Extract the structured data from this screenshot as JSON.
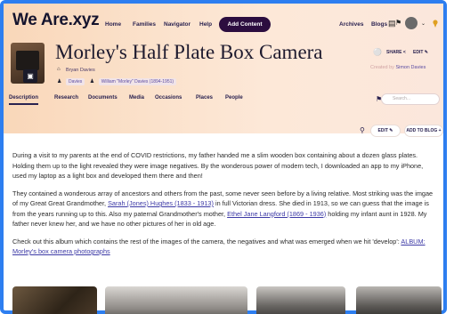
{
  "brand": {
    "logo": "We Are.xyz"
  },
  "topnav": {
    "links": [
      "Home",
      "Families",
      "Navigator",
      "Help"
    ],
    "add_content": "Add Content",
    "right_links": [
      "Archives",
      "Blogs"
    ]
  },
  "album": {
    "title": "Morley's Half Plate Box Camera",
    "owner": "Bryan Davies",
    "tags": [
      "Davies",
      "William \"Morley\" Davies (1894-1951)"
    ],
    "share_label": "SHARE",
    "edit_label": "EDIT",
    "created_by_prefix": "Created by",
    "created_by_name": "Simon Davies"
  },
  "tabs": [
    "Description",
    "Research",
    "Documents",
    "Media",
    "Occasions",
    "Places",
    "People"
  ],
  "search": {
    "placeholder": "Search..."
  },
  "actions": {
    "edit": "EDIT",
    "add_to_blog": "ADD TO BLOG +"
  },
  "content": {
    "p1": "During a visit to my parents at the end of COVID restrictions, my father handed me a slim wooden box containing about a dozen glass plates. Holding them up to the light revealed they were image negatives. By the wonderous power of modern tech, I downloaded an app to my iPhone, used my laptop as a light box and developed them there and then!",
    "p2_a": "They contained a wonderous array of ancestors and others from the past, some never seen before by a living relative. Most striking was the imgae of my Great Great Grandmother, ",
    "p2_link1": "Sarah (Jones) Hughes (1833 - 1913)",
    "p2_b": " in full Victorian dress. She died in 1913, so we can guess that the image is from the years running up to this. Also my paternal Grandmother's mother, ",
    "p2_link2": "Ethel Jane Langford (1869 - 1936)",
    "p2_c": " holding my infant aunt in 1928. My father never knew her, and we have no other pictures of her in old age.",
    "p3_a": "Check out this album which contains the rest of the images of the camera, the negatives and what was emerged when we hit 'develop': ",
    "p3_link": "ALBUM: Morley's box camera photographs"
  },
  "colors": {
    "accent": "#2c0d3f",
    "link": "#3d3aa6",
    "frame": "#2d7ef0"
  }
}
